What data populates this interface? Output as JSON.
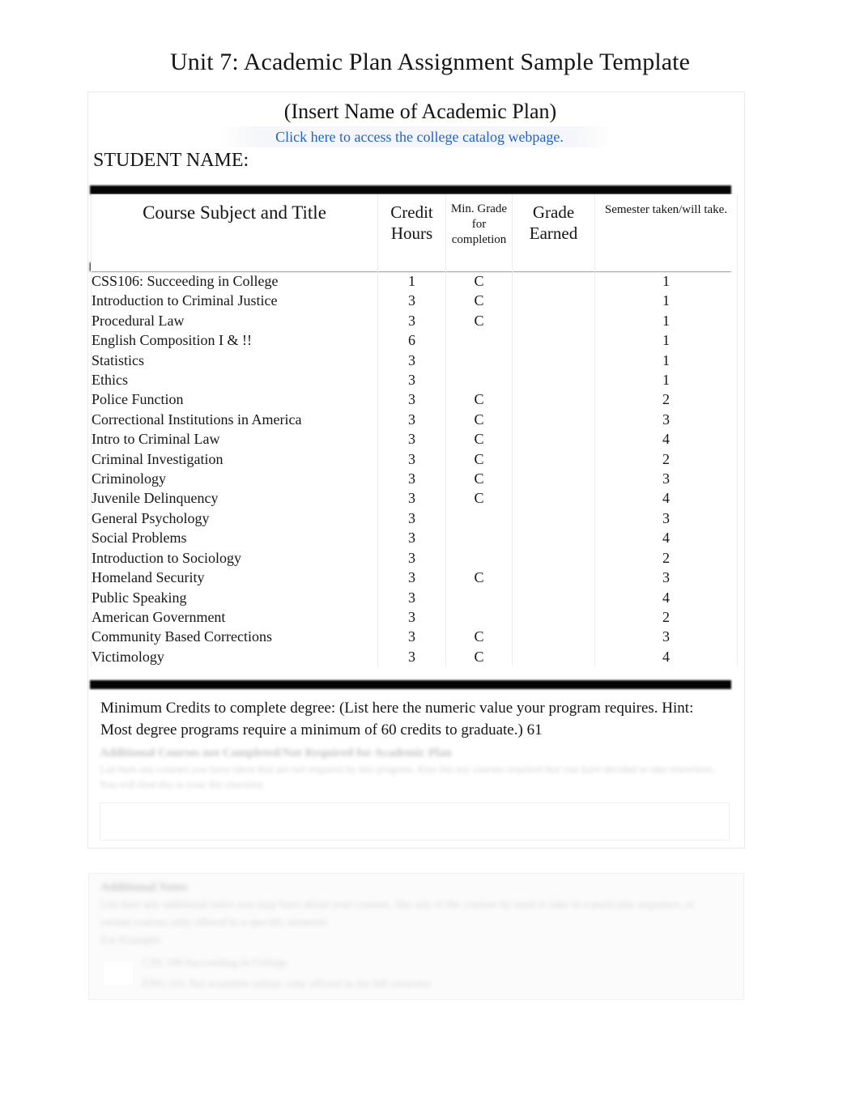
{
  "document": {
    "title": "Unit 7: Academic Plan Assignment Sample Template",
    "plan_name": "(Insert Name of Academic Plan)",
    "catalog_link": "Click here to access the college catalog webpage.",
    "student_name_label": "STUDENT NAME:",
    "link_color": "#2563c0",
    "separator_color": "#050505"
  },
  "table": {
    "headers": {
      "course": "Course Subject and Title",
      "credit_hours": "Credit Hours",
      "min_grade": "Min. Grade for completion",
      "grade_earned": "Grade Earned",
      "semester": "Semester taken/will take."
    },
    "columns": [
      "Course Subject and Title",
      "Credit Hours",
      "Min. Grade for completion",
      "Grade Earned",
      "Semester taken/will take."
    ],
    "rows": [
      {
        "course": "CSS106: Succeeding in College",
        "credit_hours": "1",
        "min_grade": "C",
        "grade_earned": "",
        "semester": "1"
      },
      {
        "course": "Introduction to Criminal Justice",
        "credit_hours": "3",
        "min_grade": "C",
        "grade_earned": "",
        "semester": "1"
      },
      {
        "course": "Procedural Law",
        "credit_hours": "3",
        "min_grade": "C",
        "grade_earned": "",
        "semester": "1"
      },
      {
        "course": "English Composition I & !!",
        "credit_hours": "6",
        "min_grade": "",
        "grade_earned": "",
        "semester": "1"
      },
      {
        "course": "Statistics",
        "credit_hours": "3",
        "min_grade": "",
        "grade_earned": "",
        "semester": "1"
      },
      {
        "course": "Ethics",
        "credit_hours": "3",
        "min_grade": "",
        "grade_earned": "",
        "semester": "1"
      },
      {
        "course": "Police Function",
        "credit_hours": "3",
        "min_grade": "C",
        "grade_earned": "",
        "semester": "2"
      },
      {
        "course": "Correctional Institutions in America",
        "credit_hours": "3",
        "min_grade": "C",
        "grade_earned": "",
        "semester": "3"
      },
      {
        "course": "Intro to Criminal Law",
        "credit_hours": "3",
        "min_grade": "C",
        "grade_earned": "",
        "semester": "4"
      },
      {
        "course": "Criminal Investigation",
        "credit_hours": "3",
        "min_grade": "C",
        "grade_earned": "",
        "semester": "2"
      },
      {
        "course": "Criminology",
        "credit_hours": "3",
        "min_grade": "C",
        "grade_earned": "",
        "semester": "3"
      },
      {
        "course": "Juvenile Delinquency",
        "credit_hours": "3",
        "min_grade": "C",
        "grade_earned": "",
        "semester": "4"
      },
      {
        "course": "General Psychology",
        "credit_hours": "3",
        "min_grade": "",
        "grade_earned": "",
        "semester": "3"
      },
      {
        "course": "Social Problems",
        "credit_hours": "3",
        "min_grade": "",
        "grade_earned": "",
        "semester": "4"
      },
      {
        "course": "Introduction to Sociology",
        "credit_hours": "3",
        "min_grade": "",
        "grade_earned": "",
        "semester": "2"
      },
      {
        "course": "Homeland Security",
        "credit_hours": "3",
        "min_grade": "C",
        "grade_earned": "",
        "semester": "3"
      },
      {
        "course": "Public Speaking",
        "credit_hours": "3",
        "min_grade": "",
        "grade_earned": "",
        "semester": "4"
      },
      {
        "course": "American Government",
        "credit_hours": "3",
        "min_grade": "",
        "grade_earned": "",
        "semester": "2"
      },
      {
        "course": "Community Based Corrections",
        "credit_hours": "3",
        "min_grade": "C",
        "grade_earned": "",
        "semester": "3"
      },
      {
        "course": "Victimology",
        "credit_hours": "3",
        "min_grade": "C",
        "grade_earned": "",
        "semester": "4"
      }
    ]
  },
  "footer": {
    "minimum_credits": "Minimum Credits to complete degree:   (List here the numeric value your program requires. Hint: Most degree programs require a minimum of 60 credits to graduate.) 61",
    "note_heading": "Additional Courses not Completed/Not Required for Academic Plan",
    "note_body": "List here any courses you have taken that are not required by this program. Also list any courses required that you have decided to take elsewhere. You will find this in your file checklist.",
    "bottom_heading": "Additional Notes",
    "bottom_body": "List here any additional notes you may have about your courses, like any of the courses by need to take in a particular sequence, or certain courses only offered in a specific semester.",
    "bottom_example_label": "For Example:",
    "bottom_items": [
      "CSS 106 Succeeding in College",
      "ENG 101 Not available online, only offered in the fall semester."
    ]
  }
}
